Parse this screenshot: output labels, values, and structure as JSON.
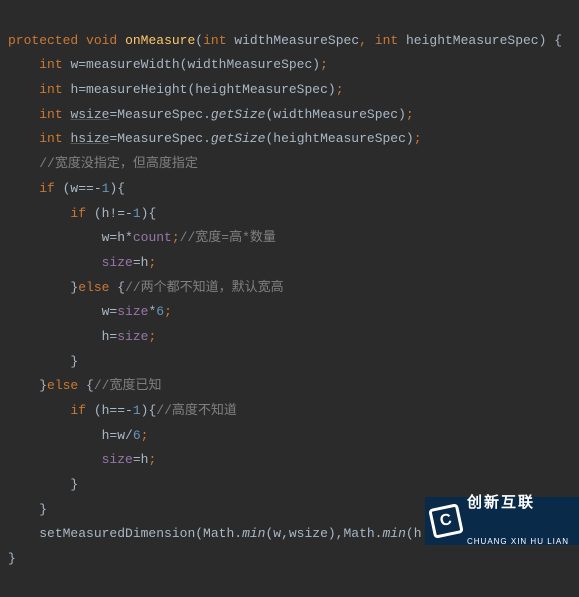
{
  "code": {
    "l1": {
      "kw1": "protected",
      "kw2": "void",
      "name": "onMeasure",
      "p1_type": "int",
      "p1_name": "widthMeasureSpec",
      "comma": ",",
      "p2_type": "int",
      "p2_name": "heightMeasureSpec",
      "open": ") {"
    },
    "l2": {
      "kw": "int",
      "var": "w=measureWidth(widthMeasureSpec)",
      "semi": ";"
    },
    "l3": {
      "kw": "int",
      "var": "h=measureHeight(heightMeasureSpec)",
      "semi": ";"
    },
    "l4": {
      "kw": "int",
      "var": "wsize",
      "eq": "=MeasureSpec.",
      "m": "getSize",
      "args": "(widthMeasureSpec)",
      "semi": ";"
    },
    "l5": {
      "kw": "int",
      "var": "hsize",
      "eq": "=MeasureSpec.",
      "m": "getSize",
      "args": "(heightMeasureSpec)",
      "semi": ";"
    },
    "l6": {
      "comment": "//宽度没指定，但高度指定"
    },
    "l7": {
      "kw": "if",
      "cond": " (w==-",
      "num": "1",
      "close": "){"
    },
    "l8": {
      "kw": "if",
      "cond": " (h!=-",
      "num": "1",
      "close": "){"
    },
    "l9": {
      "lhs": "w=h*",
      "field": "count",
      "semi": ";",
      "comment": "//宽度=高*数量"
    },
    "l10": {
      "field": "size",
      "rhs": "=h",
      "semi": ";"
    },
    "l11": {
      "brace": "}",
      "kw": "else",
      "open": " {",
      "comment": "//两个都不知道，默认宽高"
    },
    "l12": {
      "lhs": "w=",
      "field": "size",
      "star": "*",
      "num": "6",
      "semi": ";"
    },
    "l13": {
      "lhs": "h=",
      "field": "size",
      "semi": ";"
    },
    "l14": {
      "brace": "}"
    },
    "l15": {
      "brace": "}",
      "kw": "else",
      "open": " {",
      "comment": "//宽度已知"
    },
    "l16": {
      "kw": "if",
      "cond": " (h==-",
      "num": "1",
      "close": "){",
      "comment": "//高度不知道"
    },
    "l17": {
      "lhs": "h=w/",
      "num": "6",
      "semi": ";"
    },
    "l18": {
      "field": "size",
      "rhs": "=h",
      "semi": ";"
    },
    "l19": {
      "brace": "}"
    },
    "l20": {
      "brace": "}"
    },
    "l21": {
      "call": "setMeasuredDimension(Math.",
      "m1": "min",
      "a1": "(w,wsize),Math.",
      "m2": "min",
      "a2": "(h"
    },
    "l22": {
      "brace": "}"
    }
  },
  "watermark": {
    "top": "创新互联",
    "bottom": "CHUANG XIN HU LIAN"
  }
}
